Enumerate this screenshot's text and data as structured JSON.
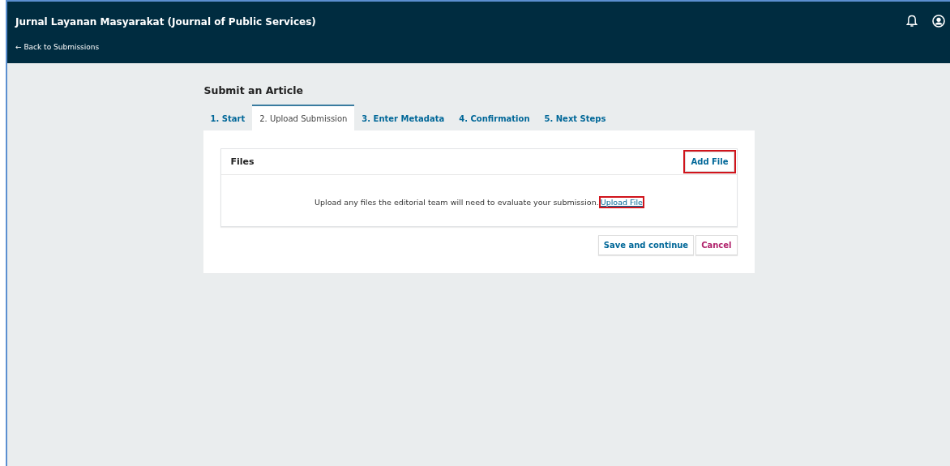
{
  "header": {
    "title": "Jurnal Layanan Masyarakat (Journal of Public Services)",
    "back_link": "← Back to Submissions"
  },
  "page_title": "Submit an Article",
  "tabs": [
    {
      "label": "1. Start",
      "selected": false
    },
    {
      "label": "2. Upload Submission",
      "selected": true
    },
    {
      "label": "3. Enter Metadata",
      "selected": false
    },
    {
      "label": "4. Confirmation",
      "selected": false
    },
    {
      "label": "5. Next Steps",
      "selected": false
    }
  ],
  "files_panel": {
    "title": "Files",
    "add_button": {
      "label": "Add File",
      "highlighted": true
    },
    "message": "Upload any files the editorial team will need to evaluate your submission.",
    "upload_link": {
      "label": "Upload File",
      "highlighted": true
    }
  },
  "actions": [
    {
      "label": "Save and continue",
      "kind": "primary"
    },
    {
      "label": "Cancel",
      "kind": "cancel"
    }
  ]
}
